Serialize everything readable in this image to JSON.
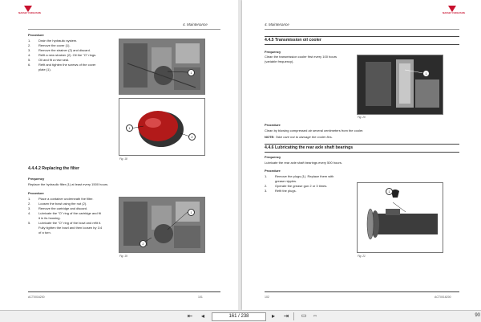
{
  "viewer": {
    "page_current": "161",
    "page_sep": "/",
    "page_total": "238",
    "zoom": "90"
  },
  "logo_text": "MASSEY FERGUSON",
  "left": {
    "section_header": "4. Maintenance",
    "procedure_label": "Procedure",
    "steps_a": [
      {
        "n": "1.",
        "text": "Drain the hydraulic system."
      },
      {
        "n": "2.",
        "text": "Remove the cover (1)."
      },
      {
        "n": "3.",
        "text": "Remove the strainer (2) and discard."
      },
      {
        "n": "4.",
        "text": "Refit a new strainer (2). Oil the \"O\" rings."
      },
      {
        "n": "5.",
        "text": "Oil and fit a new seal."
      },
      {
        "n": "6.",
        "text": "Refit and tighten the screws of the cover"
      },
      {
        "n": "",
        "text": "plate (1)."
      }
    ],
    "fig_a_callouts": [
      "1"
    ],
    "fig_b_callouts": [
      "1",
      "2"
    ],
    "fig_b_caption": "Fig. 18",
    "subsection_title": "4.4.4.2   Replacing the filter",
    "frequency_label": "Frequency",
    "frequency_text": "Replace the hydraulic filter (1) at least every 1500 hours.",
    "procedure_label_2": "Procedure",
    "steps_b": [
      {
        "n": "1.",
        "text": "Place a container underneath the filter."
      },
      {
        "n": "2.",
        "text": "Loosen the bowl using the nut (2)."
      },
      {
        "n": "3.",
        "text": "Remove the cartridge and discard."
      },
      {
        "n": "4.",
        "text": "Lubricate the \"O\" ring of the cartridge and fit"
      },
      {
        "n": "",
        "text": "it in its housing."
      },
      {
        "n": "5.",
        "text": "Lubricate the \"O\" ring of the bowl and refit it."
      },
      {
        "n": "",
        "text": "Fully tighten the bowl and then loosen by 1/4"
      },
      {
        "n": "",
        "text": "of a turn."
      }
    ],
    "fig_c_callouts": [
      "1",
      "2"
    ],
    "fig_c_caption": "Fig. 19",
    "footer_left": "ACT0016200",
    "footer_page": "101"
  },
  "right": {
    "section_header": "4. Maintenance",
    "title_445": "4.4.5   Transmission oil cooler",
    "frequency_label": "Frequency",
    "frequency_text_1": "Clean the transmission cooler first every 100 hours",
    "frequency_text_2": "(variable frequency).",
    "fig_20_callouts": [
      "1"
    ],
    "fig_20_caption": "Fig. 20",
    "procedure_label": "Procedure",
    "procedure_text": "Clean by blowing compressed air several centimeters from the cooler.",
    "note_label": "NOTE:",
    "note_text": "Take care not to damage the cooler fins.",
    "title_446": "4.4.6   Lubricating the rear axle shaft bearings",
    "frequency_label_2": "Frequency",
    "frequency_text_3": "Lubricate the rear axle shaft bearings every 500 hours.",
    "procedure_label_2": "Procedure",
    "steps": [
      {
        "n": "1.",
        "text": "Remove the plugs (1). Replace them with"
      },
      {
        "n": "",
        "text": "grease nipples."
      },
      {
        "n": "2.",
        "text": "Operate the grease gun 2 or 3 times."
      },
      {
        "n": "3.",
        "text": "Refit the plugs."
      }
    ],
    "fig_21_callouts": [
      "1"
    ],
    "fig_21_caption": "Fig. 21",
    "footer_page": "102",
    "footer_right": "ACT0016200"
  }
}
